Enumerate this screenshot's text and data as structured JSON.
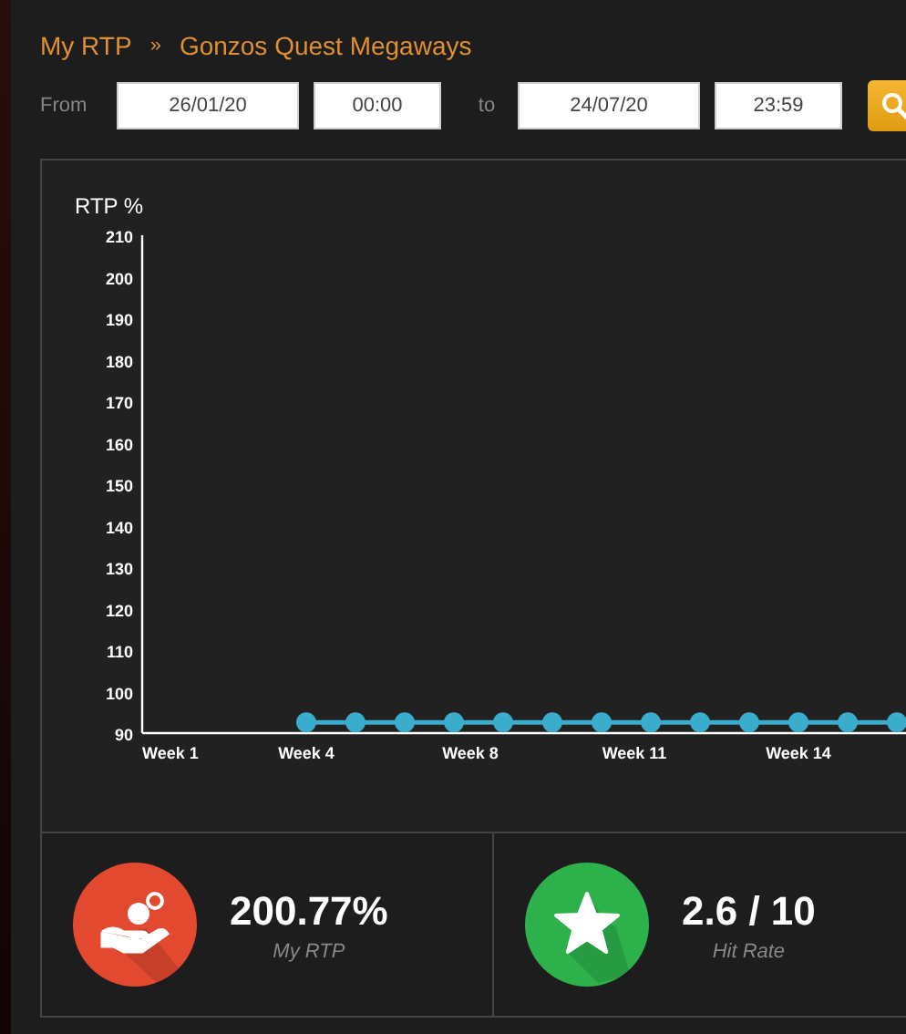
{
  "breadcrumb": {
    "root": "My RTP",
    "separator": "»",
    "current": "Gonzos Quest Megaways"
  },
  "filters": {
    "from_label": "From",
    "from_date": "26/01/20",
    "from_time": "00:00",
    "to_label": "to",
    "to_date": "24/07/20",
    "to_time": "23:59"
  },
  "chart": {
    "chart_data": {
      "type": "line",
      "ylabel": "RTP %",
      "ylim": [
        90,
        210
      ],
      "yticks": [
        90,
        100,
        110,
        120,
        130,
        140,
        150,
        160,
        170,
        180,
        190,
        200,
        210
      ],
      "categories": [
        "Week 1",
        null,
        null,
        null,
        null,
        null,
        null,
        null,
        null,
        null,
        "Week 4",
        null,
        null,
        null,
        null,
        null,
        null,
        null,
        null,
        null,
        "Week 8",
        null,
        null,
        null,
        null,
        null,
        null,
        null,
        null,
        null,
        "Week 11",
        null,
        null,
        null,
        null,
        null,
        null,
        null,
        null,
        null,
        "Week 14",
        null,
        null,
        null,
        null,
        null,
        null
      ],
      "series": [
        {
          "color": "#3aaccc",
          "marker": "circle",
          "values": [
            null,
            null,
            null,
            null,
            null,
            null,
            null,
            null,
            null,
            null,
            92.6,
            null,
            null,
            92.6,
            null,
            null,
            92.6,
            null,
            null,
            92.6,
            null,
            null,
            92.6,
            null,
            null,
            92.6,
            null,
            null,
            92.6,
            null,
            null,
            92.6,
            null,
            null,
            92.6,
            null,
            null,
            92.6,
            null,
            null,
            92.6,
            null,
            null,
            92.6,
            null,
            null,
            92.6
          ]
        }
      ]
    }
  },
  "stats": [
    {
      "kind": "coins",
      "color": "#e2492f",
      "value": "200.77%",
      "label": "My RTP"
    },
    {
      "kind": "star",
      "color": "#2db14b",
      "value": "2.6 / 10",
      "label": "Hit Rate"
    }
  ]
}
